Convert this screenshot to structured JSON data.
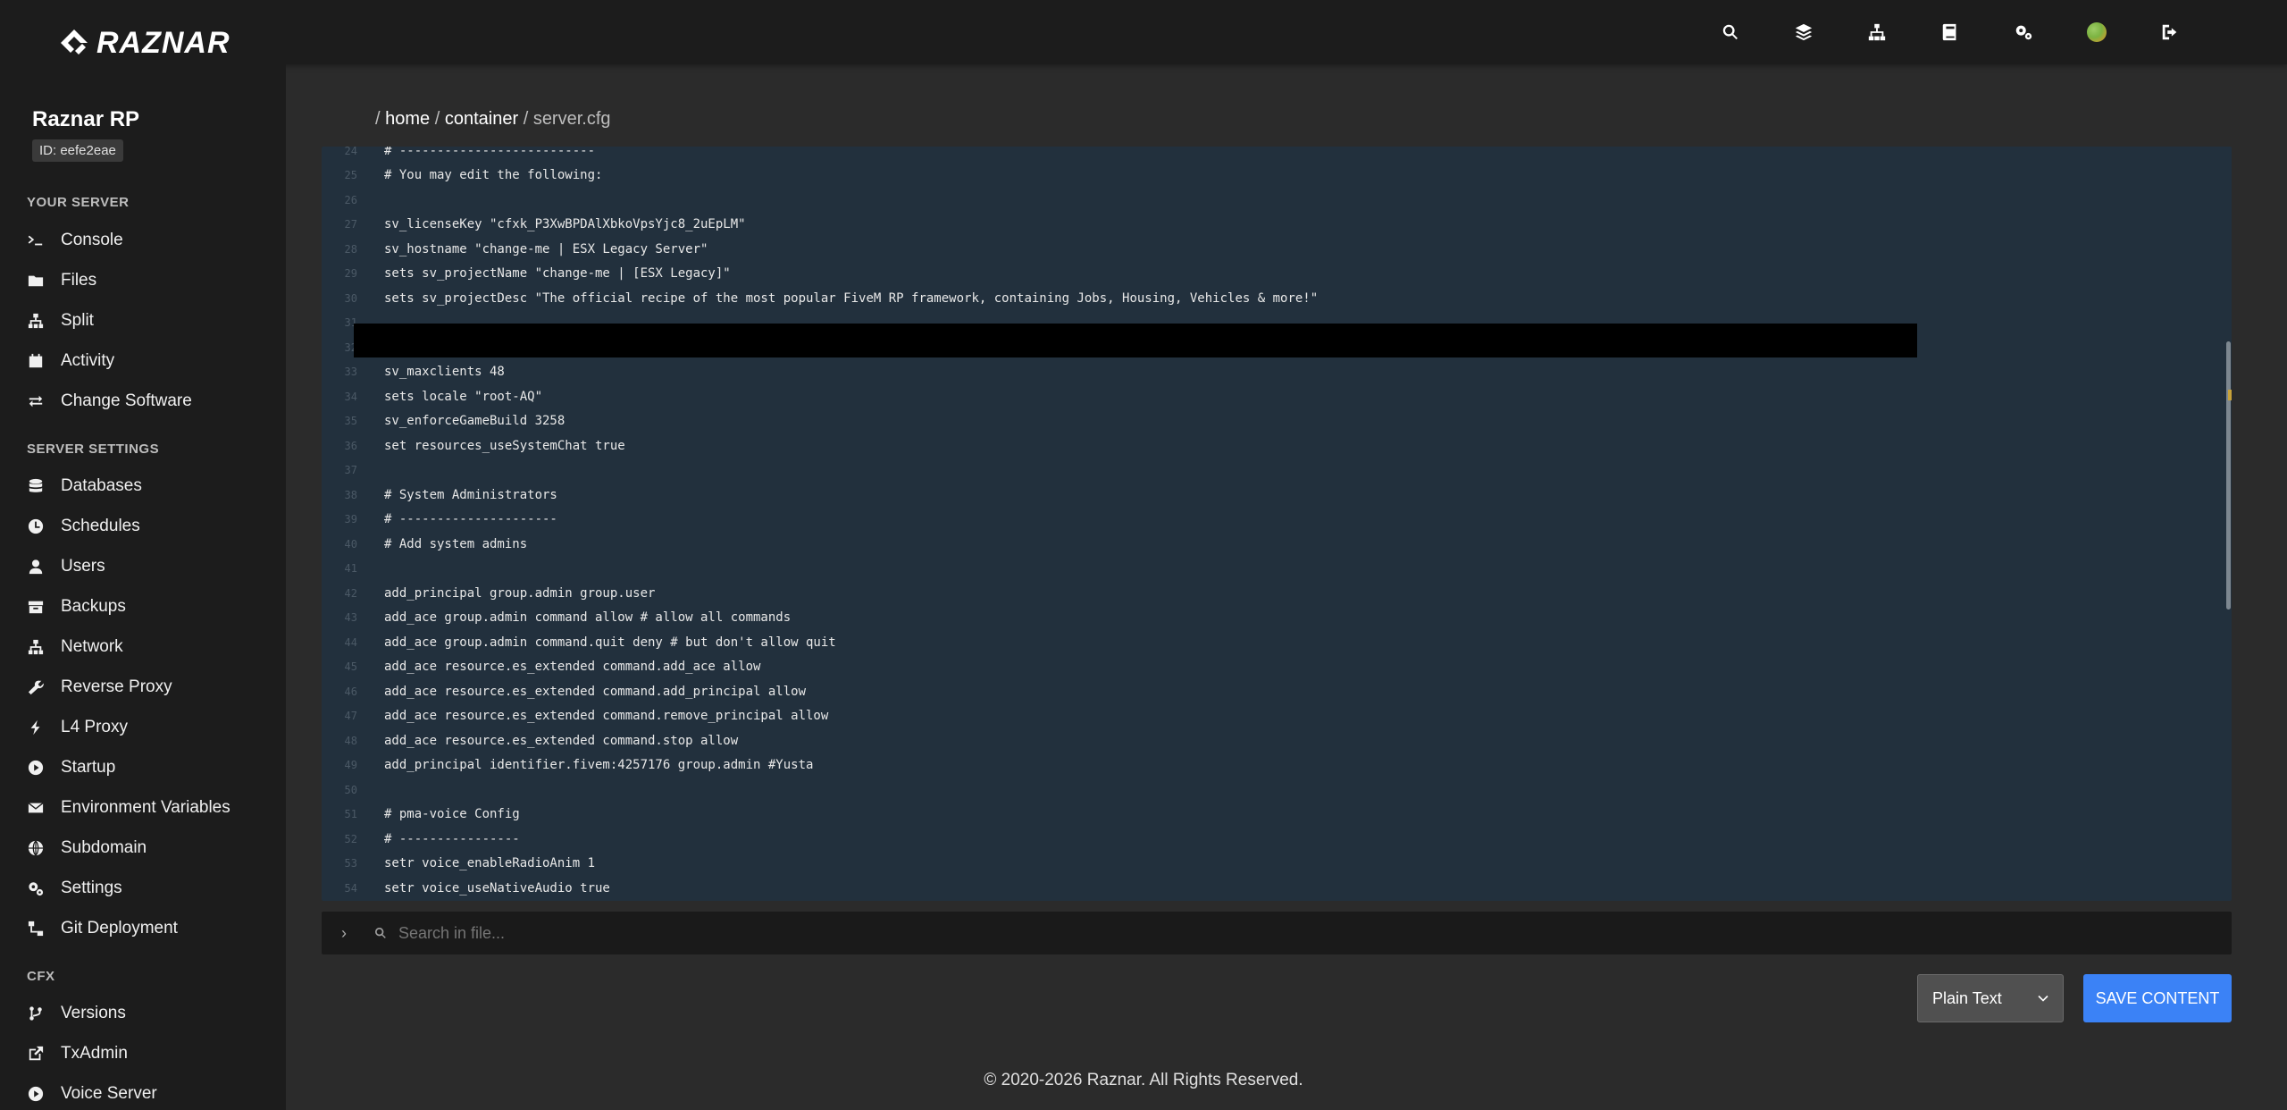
{
  "brand": {
    "name": "RAZNAR"
  },
  "topnav": [
    {
      "icon": "search-icon"
    },
    {
      "icon": "layers-icon"
    },
    {
      "icon": "sitemap-icon"
    },
    {
      "icon": "book-icon"
    },
    {
      "icon": "cogs-icon"
    },
    {
      "icon": "avatar"
    },
    {
      "icon": "sign-out-icon"
    }
  ],
  "server": {
    "name": "Raznar RP",
    "id": "ID: eefe2eae"
  },
  "sidebar": {
    "sections": [
      {
        "title": "YOUR SERVER",
        "items": [
          {
            "label": "Console",
            "icon": "terminal-icon"
          },
          {
            "label": "Files",
            "icon": "folder-icon"
          },
          {
            "label": "Split",
            "icon": "sitemap-icon"
          },
          {
            "label": "Activity",
            "icon": "calendar-icon"
          },
          {
            "label": "Change Software",
            "icon": "exchange-icon"
          }
        ]
      },
      {
        "title": "SERVER SETTINGS",
        "items": [
          {
            "label": "Databases",
            "icon": "database-icon"
          },
          {
            "label": "Schedules",
            "icon": "clock-icon"
          },
          {
            "label": "Users",
            "icon": "user-icon"
          },
          {
            "label": "Backups",
            "icon": "archive-icon"
          },
          {
            "label": "Network",
            "icon": "network-icon"
          },
          {
            "label": "Reverse Proxy",
            "icon": "wrench-icon"
          },
          {
            "label": "L4 Proxy",
            "icon": "bolt-icon"
          },
          {
            "label": "Startup",
            "icon": "play-circle-icon"
          },
          {
            "label": "Environment Variables",
            "icon": "envelope-icon"
          },
          {
            "label": "Subdomain",
            "icon": "globe-icon"
          },
          {
            "label": "Settings",
            "icon": "cogs-icon"
          },
          {
            "label": "Git Deployment",
            "icon": "code-branch-icon"
          }
        ]
      },
      {
        "title": "CFX",
        "items": [
          {
            "label": "Versions",
            "icon": "code-fork-icon"
          },
          {
            "label": "TxAdmin",
            "icon": "external-link-icon"
          },
          {
            "label": "Voice Server",
            "icon": "play-circle-icon"
          }
        ]
      }
    ]
  },
  "breadcrumb": {
    "sep": "/",
    "parts": [
      "home",
      "container",
      "server.cfg"
    ]
  },
  "editor": {
    "lines": [
      {
        "n": "24",
        "t": "# --------------------------"
      },
      {
        "n": "25",
        "t": "# You may edit the following:"
      },
      {
        "n": "26",
        "t": ""
      },
      {
        "n": "27",
        "t": "sv_licenseKey \"cfxk_P3XwBPDAlXbkoVpsYjc8_2uEpLM\""
      },
      {
        "n": "28",
        "t": "sv_hostname \"change-me | ESX Legacy Server\""
      },
      {
        "n": "29",
        "t": "sets sv_projectName \"change-me | [ESX Legacy]\""
      },
      {
        "n": "30",
        "t": "sets sv_projectDesc \"The official recipe of the most popular FiveM RP framework, containing Jobs, Housing, Vehicles & more!\""
      },
      {
        "n": "31",
        "t": ""
      },
      {
        "n": "32",
        "t": ""
      },
      {
        "n": "33",
        "t": "sv_maxclients 48"
      },
      {
        "n": "34",
        "t": "sets locale \"root-AQ\""
      },
      {
        "n": "35",
        "t": "sv_enforceGameBuild 3258"
      },
      {
        "n": "36",
        "t": "set resources_useSystemChat true"
      },
      {
        "n": "37",
        "t": ""
      },
      {
        "n": "38",
        "t": "# System Administrators"
      },
      {
        "n": "39",
        "t": "# ---------------------"
      },
      {
        "n": "40",
        "t": "# Add system admins"
      },
      {
        "n": "41",
        "t": ""
      },
      {
        "n": "42",
        "t": "add_principal group.admin group.user"
      },
      {
        "n": "43",
        "t": "add_ace group.admin command allow # allow all commands"
      },
      {
        "n": "44",
        "t": "add_ace group.admin command.quit deny # but don't allow quit"
      },
      {
        "n": "45",
        "t": "add_ace resource.es_extended command.add_ace allow"
      },
      {
        "n": "46",
        "t": "add_ace resource.es_extended command.add_principal allow"
      },
      {
        "n": "47",
        "t": "add_ace resource.es_extended command.remove_principal allow"
      },
      {
        "n": "48",
        "t": "add_ace resource.es_extended command.stop allow"
      },
      {
        "n": "49",
        "t": "add_principal identifier.fivem:4257176 group.admin #Yusta"
      },
      {
        "n": "50",
        "t": ""
      },
      {
        "n": "51",
        "t": "# pma-voice Config"
      },
      {
        "n": "52",
        "t": "# ----------------"
      },
      {
        "n": "53",
        "t": "setr voice_enableRadioAnim 1"
      },
      {
        "n": "54",
        "t": "setr voice_useNativeAudio true"
      }
    ]
  },
  "search": {
    "placeholder": "Search in file..."
  },
  "mode": {
    "value": "Plain Text"
  },
  "save_label": "SAVE CONTENT",
  "footer": {
    "prefix": "© 2020-2026",
    "brand": "Raznar.",
    "suffix": "All Rights Reserved."
  }
}
